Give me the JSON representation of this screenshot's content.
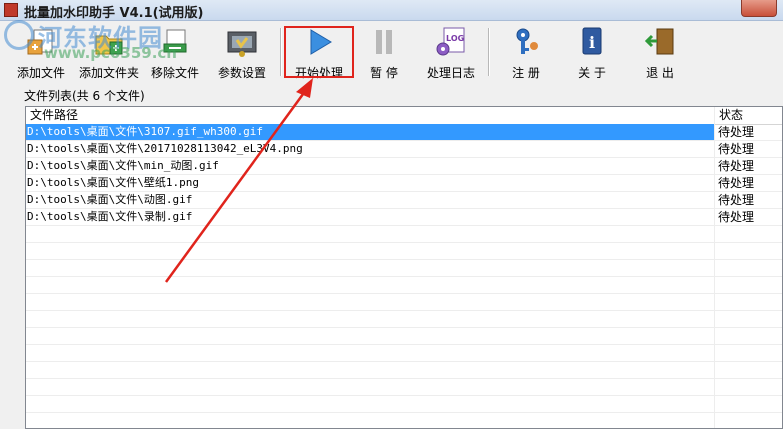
{
  "window": {
    "title": "批量加水印助手 V4.1(试用版)"
  },
  "watermark": {
    "text": "河东软件园",
    "url": "www.pc0359.cn"
  },
  "toolbar": {
    "add_file": "添加文件",
    "add_folder": "添加文件夹",
    "remove_file": "移除文件",
    "settings": "参数设置",
    "start": "开始处理",
    "pause": "暂 停",
    "log": "处理日志",
    "register": "注 册",
    "about": "关 于",
    "exit": "退 出"
  },
  "file_list": {
    "caption": "文件列表(共 6 个文件)",
    "columns": [
      "文件路径",
      "状态"
    ],
    "rows": [
      {
        "path": "D:\\tools\\桌面\\文件\\3107.gif_wh300.gif",
        "status": "待处理"
      },
      {
        "path": "D:\\tools\\桌面\\文件\\20171028113042_eL3V4.png",
        "status": "待处理"
      },
      {
        "path": "D:\\tools\\桌面\\文件\\min_动图.gif",
        "status": "待处理"
      },
      {
        "path": "D:\\tools\\桌面\\文件\\壁纸1.png",
        "status": "待处理"
      },
      {
        "path": "D:\\tools\\桌面\\文件\\动图.gif",
        "status": "待处理"
      },
      {
        "path": "D:\\tools\\桌面\\文件\\录制.gif",
        "status": "待处理"
      }
    ]
  },
  "colors": {
    "highlight": "#e0241c",
    "selection": "#3399ff"
  }
}
